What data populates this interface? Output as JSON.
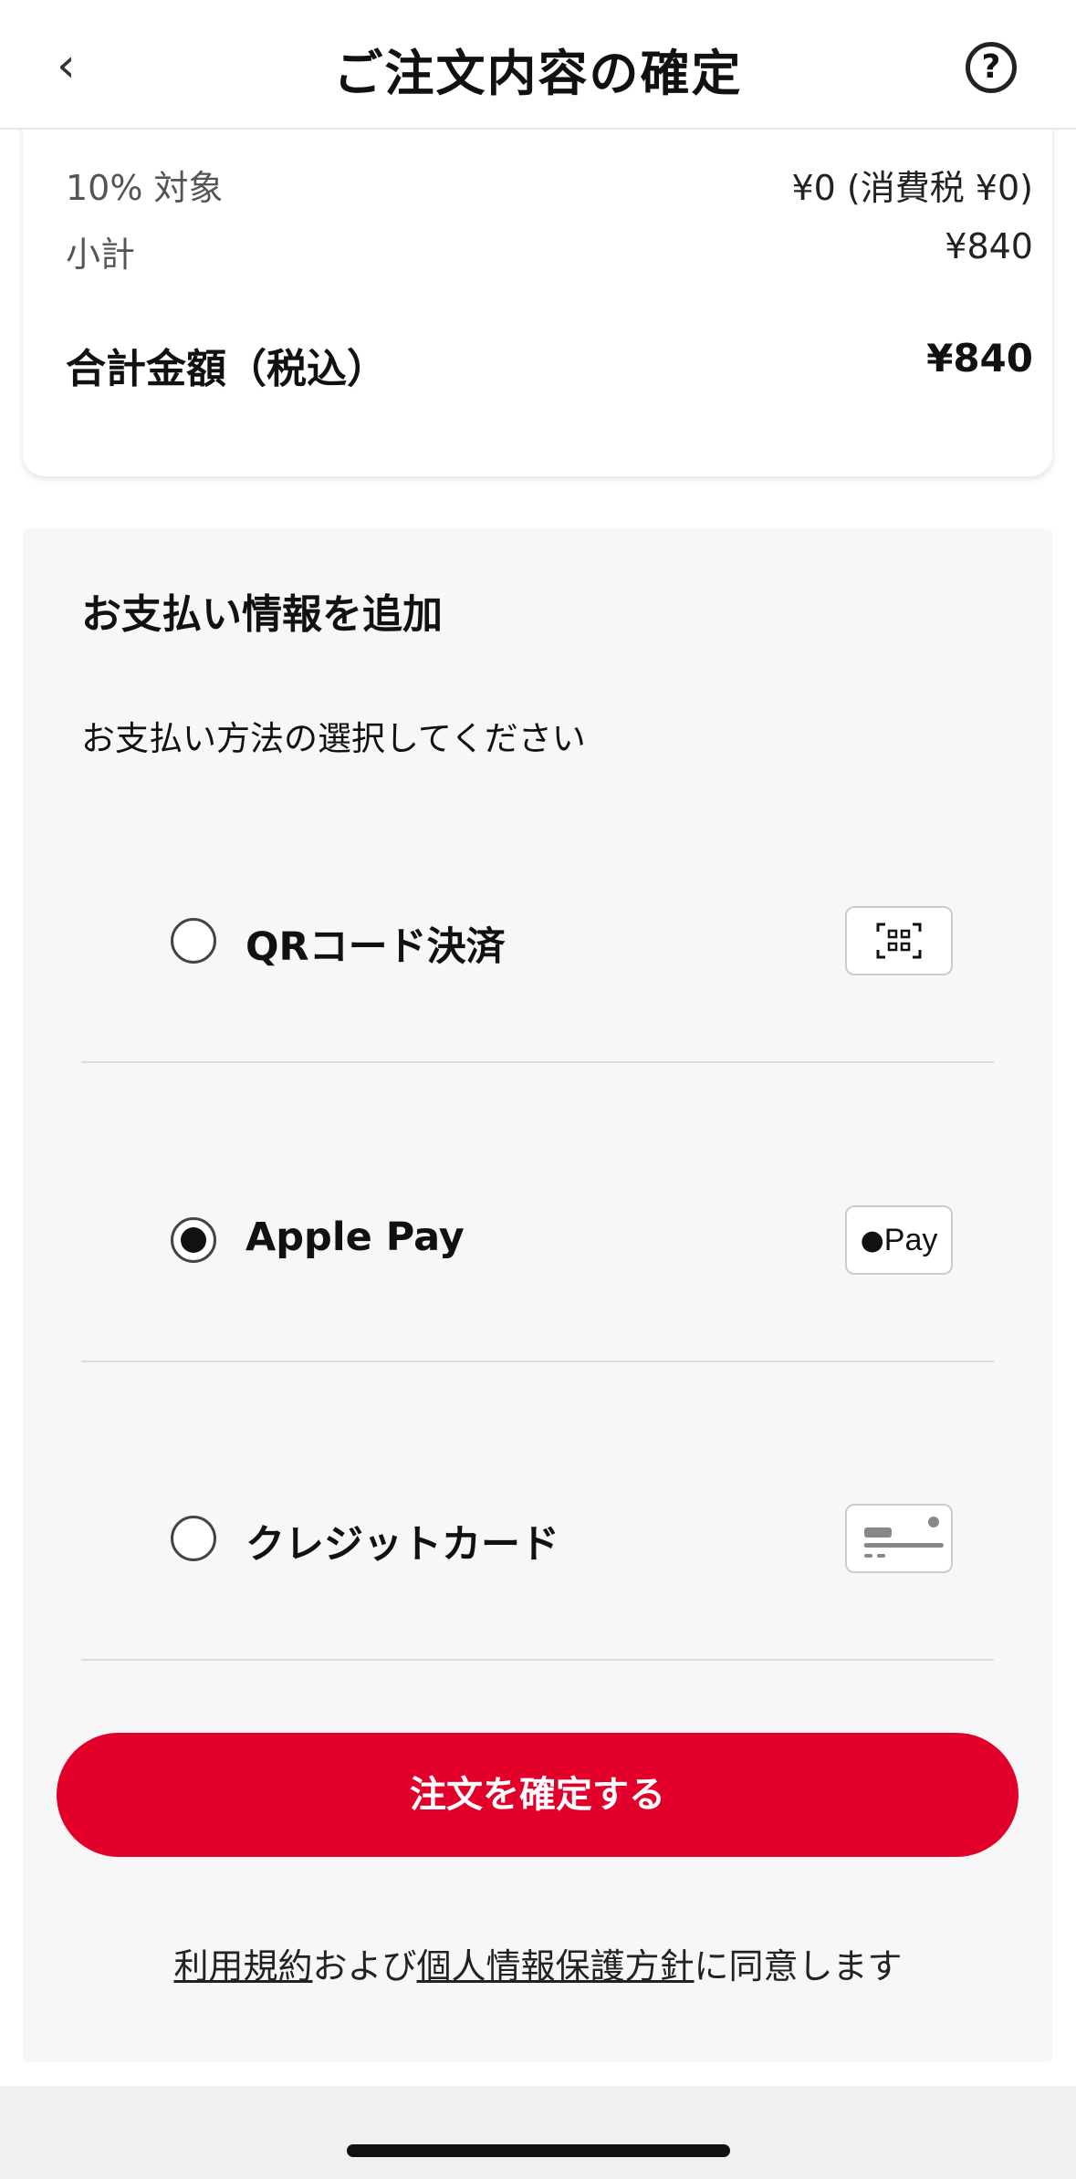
{
  "header": {
    "title": "ご注文内容の確定",
    "back_icon": "chevron-left-icon",
    "help_icon": "question-circle-icon"
  },
  "summary": {
    "rows": [
      {
        "label": "10% 対象",
        "value": "¥0 (消費税 ¥0)"
      },
      {
        "label": "小計",
        "value": "¥840"
      }
    ],
    "total_label": "合計金額（税込）",
    "total_value": "¥840"
  },
  "payment": {
    "title": "お支払い情報を追加",
    "subtitle": "お支払い方法の選択してください",
    "options": [
      {
        "label": "QRコード決済",
        "selected": false,
        "icon": "qr-scan-icon"
      },
      {
        "label": "Apple Pay",
        "selected": true,
        "icon": "apple-pay-icon",
        "badge_text": "Pay"
      },
      {
        "label": "クレジットカード",
        "selected": false,
        "icon": "credit-card-icon"
      }
    ]
  },
  "confirm_label": "注文を確定する",
  "terms": {
    "link1": "利用規約",
    "mid": "および",
    "link2": "個人情報保護方針",
    "end": "に同意します"
  },
  "colors": {
    "accent": "#e2002b"
  }
}
